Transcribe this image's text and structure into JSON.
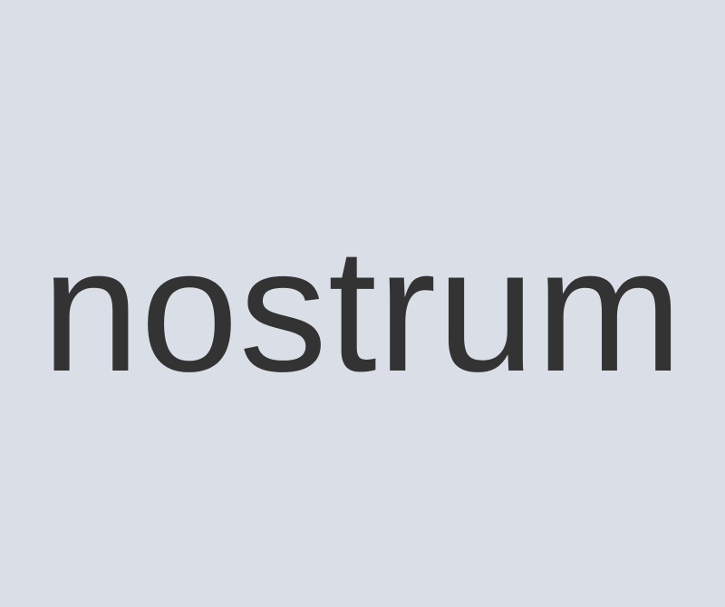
{
  "word": "nostrum",
  "colors": {
    "background": "#dadfe7",
    "text": "#333333"
  }
}
